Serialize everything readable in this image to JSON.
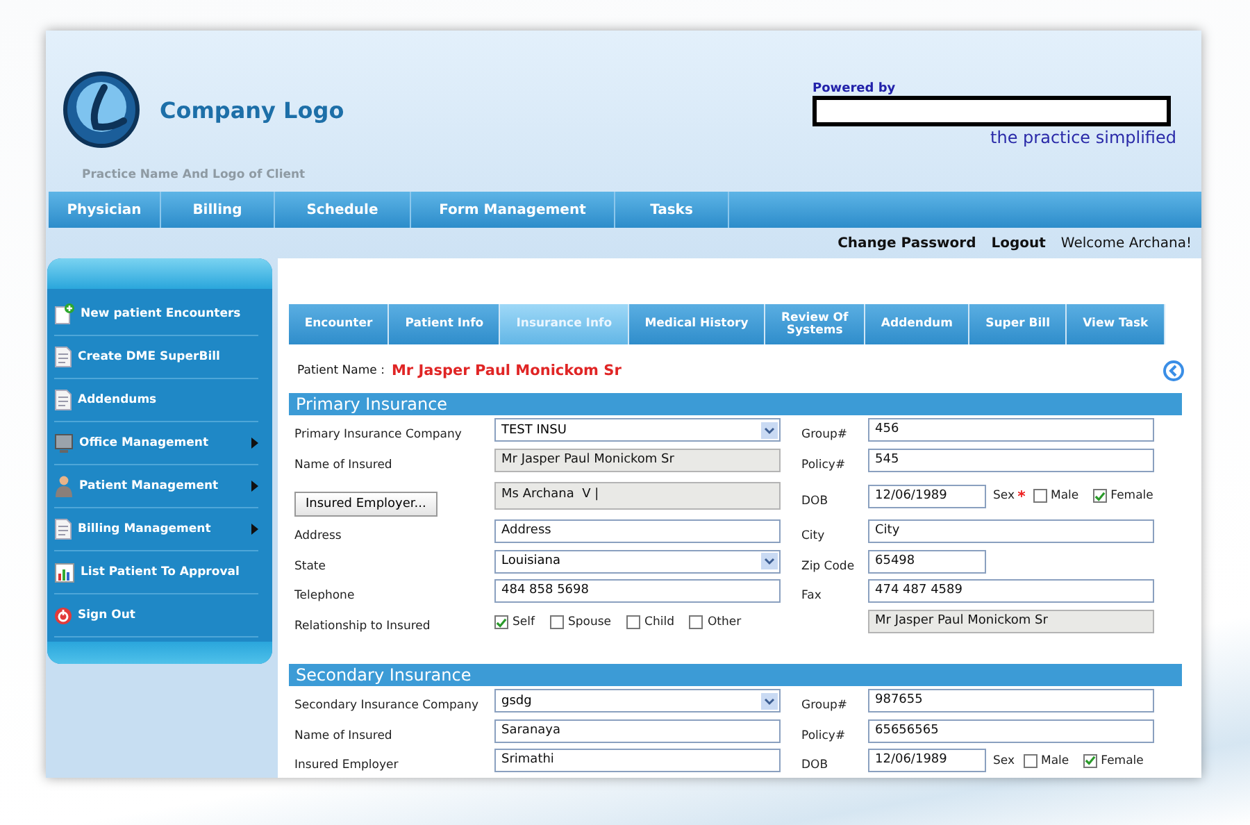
{
  "header": {
    "logo_text": "Company Logo",
    "subtitle": "Practice Name And Logo of Client",
    "powered_by": "Powered by",
    "tagline": "the practice simplified"
  },
  "nav": [
    "Physician",
    "Billing",
    "Schedule",
    "Form Management",
    "Tasks"
  ],
  "user_bar": {
    "links": [
      "Change Password",
      "Logout"
    ],
    "welcome": "Welcome Archana!"
  },
  "sidebar": {
    "items": [
      {
        "label": "New patient Encounters",
        "kind": "new",
        "has_submenu": false
      },
      {
        "label": "Create DME SuperBill",
        "kind": "doc",
        "has_submenu": false
      },
      {
        "label": "Addendums",
        "kind": "doc",
        "has_submenu": false
      },
      {
        "label": "Office Management",
        "kind": "office",
        "has_submenu": true
      },
      {
        "label": "Patient Management",
        "kind": "user",
        "has_submenu": true
      },
      {
        "label": "Billing Management",
        "kind": "doc",
        "has_submenu": true
      },
      {
        "label": "List Patient To Approval",
        "kind": "list",
        "has_submenu": false
      },
      {
        "label": "Sign Out",
        "kind": "exit",
        "has_submenu": false
      }
    ]
  },
  "tabs": [
    {
      "label": "Encounter",
      "selected": false
    },
    {
      "label": "Patient Info",
      "selected": false
    },
    {
      "label": "Insurance Info",
      "selected": true
    },
    {
      "label": "Medical History",
      "selected": false
    },
    {
      "label": "Review Of Systems",
      "selected": false
    },
    {
      "label": "Addendum",
      "selected": false
    },
    {
      "label": "Super Bill",
      "selected": false
    },
    {
      "label": "View Task",
      "selected": false
    }
  ],
  "patient": {
    "label": "Patient Name :",
    "name": "Mr Jasper Paul Monickom Sr"
  },
  "sections": [
    {
      "title": "Primary Insurance",
      "rows": [
        {
          "left_label": "Primary Insurance Company",
          "left": {
            "kind": "select",
            "value": "TEST INSU"
          },
          "right_label": "Group#",
          "right": {
            "kind": "text",
            "value": "456"
          }
        },
        {
          "left_label": "Name of Insured",
          "left": {
            "kind": "readonly",
            "value": "Mr Jasper Paul Monickom Sr"
          },
          "right_label": "Policy#",
          "right": {
            "kind": "text",
            "value": "545"
          }
        },
        {
          "left_button": "Insured Employer...",
          "left": {
            "kind": "readonly",
            "value": "Ms Archana  V |"
          },
          "right_label": "DOB",
          "right": {
            "kind": "date",
            "value": "12/06/1989"
          },
          "sex": {
            "label": "Sex",
            "required": true,
            "options": [
              {
                "label": "Male",
                "checked": false
              },
              {
                "label": "Female",
                "checked": true
              }
            ]
          }
        },
        {
          "left_label": "Address",
          "left": {
            "kind": "text",
            "value": "Address"
          },
          "right_label": "City",
          "right": {
            "kind": "text",
            "value": "City"
          }
        },
        {
          "left_label": "State",
          "left": {
            "kind": "select",
            "value": "Louisiana"
          },
          "right_label": "Zip Code",
          "right": {
            "kind": "short",
            "value": "65498"
          }
        },
        {
          "left_label": "Telephone",
          "left": {
            "kind": "text",
            "value": "484 858 5698"
          },
          "right_label": "Fax",
          "right": {
            "kind": "text",
            "value": "474 487 4589"
          }
        },
        {
          "left_label": "Relationship to Insured",
          "left": {
            "kind": "checks",
            "options": [
              {
                "label": "Self",
                "checked": true
              },
              {
                "label": "Spouse",
                "checked": false
              },
              {
                "label": "Child",
                "checked": false
              },
              {
                "label": "Other",
                "checked": false
              }
            ]
          },
          "right": {
            "kind": "readonly",
            "value": "Mr Jasper Paul Monickom Sr"
          }
        }
      ]
    },
    {
      "title": "Secondary Insurance",
      "rows": [
        {
          "left_label": "Secondary Insurance Company",
          "left": {
            "kind": "select",
            "value": "gsdg"
          },
          "right_label": "Group#",
          "right": {
            "kind": "text",
            "value": "987655"
          }
        },
        {
          "left_label": "Name of Insured",
          "left": {
            "kind": "text",
            "value": "Saranaya"
          },
          "right_label": "Policy#",
          "right": {
            "kind": "text",
            "value": "65656565"
          }
        },
        {
          "left_label": "Insured Employer",
          "left": {
            "kind": "text",
            "value": "Srimathi"
          },
          "right_label": "DOB",
          "right": {
            "kind": "date",
            "value": "12/06/1989"
          },
          "sex": {
            "label": "Sex",
            "required": false,
            "options": [
              {
                "label": "Male",
                "checked": false
              },
              {
                "label": "Female",
                "checked": true
              }
            ]
          }
        }
      ]
    }
  ]
}
